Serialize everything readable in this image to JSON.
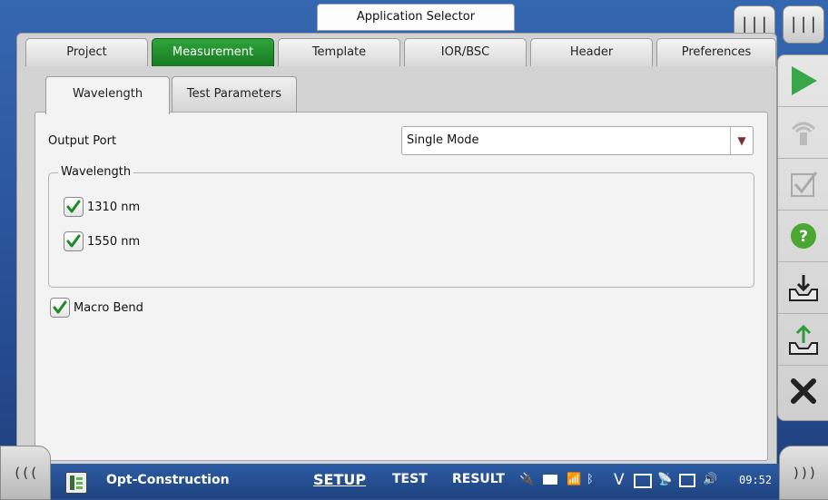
{
  "window": {
    "app_selector_label": "Application Selector"
  },
  "corner_buttons": {
    "left_symbol": "|||",
    "right_symbol": "|||"
  },
  "tabs": [
    {
      "label": "Project",
      "active": false
    },
    {
      "label": "Measurement",
      "active": true
    },
    {
      "label": "Template",
      "active": false
    },
    {
      "label": "IOR/BSC",
      "active": false
    },
    {
      "label": "Header",
      "active": false
    },
    {
      "label": "Preferences",
      "active": false
    }
  ],
  "subtabs": [
    {
      "label": "Wavelength",
      "active": true
    },
    {
      "label": "Test Parameters",
      "active": false
    }
  ],
  "form": {
    "output_port_label": "Output Port",
    "output_port_value": "Single Mode",
    "wavelength_group_title": "Wavelength",
    "wavelengths": [
      {
        "label": "1310 nm",
        "checked": true
      },
      {
        "label": "1550 nm",
        "checked": true
      }
    ],
    "macro_bend_label": "Macro Bend",
    "macro_bend_checked": true
  },
  "right_toolbar": [
    {
      "icon": "play-icon"
    },
    {
      "icon": "laser-source-icon"
    },
    {
      "icon": "checklist-icon"
    },
    {
      "icon": "help-icon"
    },
    {
      "icon": "save-tray-icon"
    },
    {
      "icon": "open-tray-icon"
    },
    {
      "icon": "close-icon"
    }
  ],
  "bottom_bar": {
    "left_symbol": "(((",
    "right_symbol": ")))",
    "app_name": "Opt-Construction",
    "nav": {
      "setup": "SETUP",
      "test": "TEST",
      "result": "RESULT"
    },
    "clock": "09:52"
  },
  "colors": {
    "active_tab": "#1f8f2b",
    "play_green": "#3aa64a",
    "help_green": "#4aa832",
    "background_blue": "#2a4f8c"
  }
}
